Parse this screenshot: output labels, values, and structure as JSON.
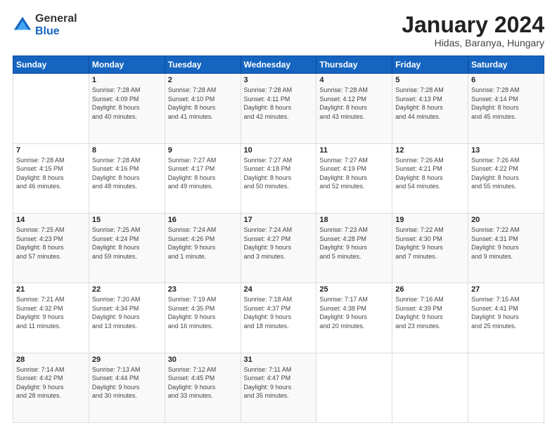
{
  "logo": {
    "general": "General",
    "blue": "Blue"
  },
  "title": "January 2024",
  "location": "Hidas, Baranya, Hungary",
  "weekdays": [
    "Sunday",
    "Monday",
    "Tuesday",
    "Wednesday",
    "Thursday",
    "Friday",
    "Saturday"
  ],
  "weeks": [
    [
      {
        "day": "",
        "info": ""
      },
      {
        "day": "1",
        "info": "Sunrise: 7:28 AM\nSunset: 4:09 PM\nDaylight: 8 hours\nand 40 minutes."
      },
      {
        "day": "2",
        "info": "Sunrise: 7:28 AM\nSunset: 4:10 PM\nDaylight: 8 hours\nand 41 minutes."
      },
      {
        "day": "3",
        "info": "Sunrise: 7:28 AM\nSunset: 4:11 PM\nDaylight: 8 hours\nand 42 minutes."
      },
      {
        "day": "4",
        "info": "Sunrise: 7:28 AM\nSunset: 4:12 PM\nDaylight: 8 hours\nand 43 minutes."
      },
      {
        "day": "5",
        "info": "Sunrise: 7:28 AM\nSunset: 4:13 PM\nDaylight: 8 hours\nand 44 minutes."
      },
      {
        "day": "6",
        "info": "Sunrise: 7:28 AM\nSunset: 4:14 PM\nDaylight: 8 hours\nand 45 minutes."
      }
    ],
    [
      {
        "day": "7",
        "info": "Sunrise: 7:28 AM\nSunset: 4:15 PM\nDaylight: 8 hours\nand 46 minutes."
      },
      {
        "day": "8",
        "info": "Sunrise: 7:28 AM\nSunset: 4:16 PM\nDaylight: 8 hours\nand 48 minutes."
      },
      {
        "day": "9",
        "info": "Sunrise: 7:27 AM\nSunset: 4:17 PM\nDaylight: 8 hours\nand 49 minutes."
      },
      {
        "day": "10",
        "info": "Sunrise: 7:27 AM\nSunset: 4:18 PM\nDaylight: 8 hours\nand 50 minutes."
      },
      {
        "day": "11",
        "info": "Sunrise: 7:27 AM\nSunset: 4:19 PM\nDaylight: 8 hours\nand 52 minutes."
      },
      {
        "day": "12",
        "info": "Sunrise: 7:26 AM\nSunset: 4:21 PM\nDaylight: 8 hours\nand 54 minutes."
      },
      {
        "day": "13",
        "info": "Sunrise: 7:26 AM\nSunset: 4:22 PM\nDaylight: 8 hours\nand 55 minutes."
      }
    ],
    [
      {
        "day": "14",
        "info": "Sunrise: 7:25 AM\nSunset: 4:23 PM\nDaylight: 8 hours\nand 57 minutes."
      },
      {
        "day": "15",
        "info": "Sunrise: 7:25 AM\nSunset: 4:24 PM\nDaylight: 8 hours\nand 59 minutes."
      },
      {
        "day": "16",
        "info": "Sunrise: 7:24 AM\nSunset: 4:26 PM\nDaylight: 9 hours\nand 1 minute."
      },
      {
        "day": "17",
        "info": "Sunrise: 7:24 AM\nSunset: 4:27 PM\nDaylight: 9 hours\nand 3 minutes."
      },
      {
        "day": "18",
        "info": "Sunrise: 7:23 AM\nSunset: 4:28 PM\nDaylight: 9 hours\nand 5 minutes."
      },
      {
        "day": "19",
        "info": "Sunrise: 7:22 AM\nSunset: 4:30 PM\nDaylight: 9 hours\nand 7 minutes."
      },
      {
        "day": "20",
        "info": "Sunrise: 7:22 AM\nSunset: 4:31 PM\nDaylight: 9 hours\nand 9 minutes."
      }
    ],
    [
      {
        "day": "21",
        "info": "Sunrise: 7:21 AM\nSunset: 4:32 PM\nDaylight: 9 hours\nand 11 minutes."
      },
      {
        "day": "22",
        "info": "Sunrise: 7:20 AM\nSunset: 4:34 PM\nDaylight: 9 hours\nand 13 minutes."
      },
      {
        "day": "23",
        "info": "Sunrise: 7:19 AM\nSunset: 4:35 PM\nDaylight: 9 hours\nand 16 minutes."
      },
      {
        "day": "24",
        "info": "Sunrise: 7:18 AM\nSunset: 4:37 PM\nDaylight: 9 hours\nand 18 minutes."
      },
      {
        "day": "25",
        "info": "Sunrise: 7:17 AM\nSunset: 4:38 PM\nDaylight: 9 hours\nand 20 minutes."
      },
      {
        "day": "26",
        "info": "Sunrise: 7:16 AM\nSunset: 4:39 PM\nDaylight: 9 hours\nand 23 minutes."
      },
      {
        "day": "27",
        "info": "Sunrise: 7:15 AM\nSunset: 4:41 PM\nDaylight: 9 hours\nand 25 minutes."
      }
    ],
    [
      {
        "day": "28",
        "info": "Sunrise: 7:14 AM\nSunset: 4:42 PM\nDaylight: 9 hours\nand 28 minutes."
      },
      {
        "day": "29",
        "info": "Sunrise: 7:13 AM\nSunset: 4:44 PM\nDaylight: 9 hours\nand 30 minutes."
      },
      {
        "day": "30",
        "info": "Sunrise: 7:12 AM\nSunset: 4:45 PM\nDaylight: 9 hours\nand 33 minutes."
      },
      {
        "day": "31",
        "info": "Sunrise: 7:11 AM\nSunset: 4:47 PM\nDaylight: 9 hours\nand 35 minutes."
      },
      {
        "day": "",
        "info": ""
      },
      {
        "day": "",
        "info": ""
      },
      {
        "day": "",
        "info": ""
      }
    ]
  ]
}
